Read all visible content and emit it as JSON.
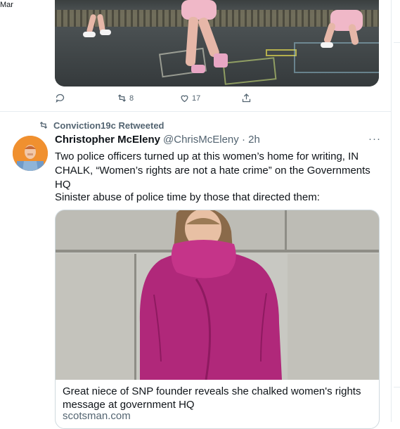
{
  "header_fragment": "Mar",
  "previous_tweet": {
    "image_alt_icon": "photo",
    "reply_count": "",
    "retweet_count": "8",
    "like_count": "17"
  },
  "retweet": {
    "by": "Conviction19c Retweeted"
  },
  "tweet": {
    "author_name": "Christopher McEleny",
    "handle_time": "@ChrisMcEleny · 2h",
    "more": "···",
    "text_1": "Two police officers  turned up at this women’s home for writing, IN CHALK, “Women’s rights are not a hate crime” on the Governments HQ",
    "text_2": "Sinister abuse of police time by those that directed them:",
    "card": {
      "title": "Great niece of SNP founder reveals she chalked women's rights message at government HQ",
      "domain": "scotsman.com"
    }
  },
  "colors": {
    "muted": "#536471",
    "text": "#0f1419",
    "border": "#cfd9de",
    "sweater": "#b0287a"
  }
}
